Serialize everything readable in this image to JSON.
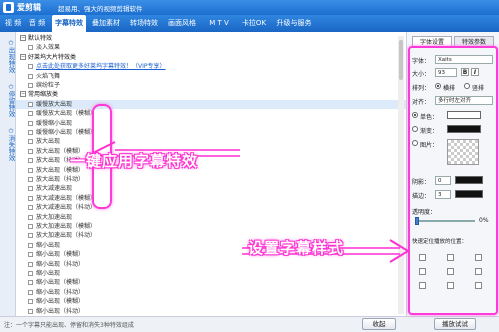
{
  "app": {
    "name": "爱剪辑",
    "slogan": "超易用、强大的视频剪辑软件"
  },
  "menu": [
    {
      "label": "视 频",
      "active": false
    },
    {
      "label": "音 频",
      "active": false
    },
    {
      "label": "字幕特效",
      "active": true
    },
    {
      "label": "叠加素材",
      "active": false
    },
    {
      "label": "转场特效",
      "active": false
    },
    {
      "label": "画面风格",
      "active": false
    },
    {
      "label": "M T V",
      "active": false
    },
    {
      "label": "卡拉OK",
      "active": false
    },
    {
      "label": "升级与服务",
      "active": false
    }
  ],
  "left_tabs": [
    "出现特效",
    "停留特效",
    "消失特效"
  ],
  "effects_list": [
    {
      "type": "group",
      "label": "默认特效"
    },
    {
      "type": "item",
      "label": "淡入效果"
    },
    {
      "type": "group",
      "label": "好莱坞大片特效类"
    },
    {
      "type": "link",
      "label": "点击此处获取更多好莱坞字幕特效！（VIP专享）"
    },
    {
      "type": "item",
      "label": "火焰飞舞"
    },
    {
      "type": "item",
      "label": "缤纷粒子"
    },
    {
      "type": "group",
      "label": "常用缩放类"
    },
    {
      "type": "item",
      "label": "缓慢放大出现",
      "selected": true
    },
    {
      "type": "item",
      "label": "缓慢放大出现（模糊）"
    },
    {
      "type": "item",
      "label": "缓慢缩小出现"
    },
    {
      "type": "item",
      "label": "缓慢缩小出现（模糊）"
    },
    {
      "type": "item",
      "label": "放大出现"
    },
    {
      "type": "item",
      "label": "放大出现（模糊）"
    },
    {
      "type": "item",
      "label": "放大出现（抖动）"
    },
    {
      "type": "item",
      "label": "放大出现（模糊）"
    },
    {
      "type": "item",
      "label": "放大出现（抖动）"
    },
    {
      "type": "item",
      "label": "放大减速出现"
    },
    {
      "type": "item",
      "label": "放大减速出现（模糊）"
    },
    {
      "type": "item",
      "label": "放大减速出现（抖动）"
    },
    {
      "type": "item",
      "label": "放大加速出现"
    },
    {
      "type": "item",
      "label": "放大加速出现（模糊）"
    },
    {
      "type": "item",
      "label": "放大加速出现（抖动）"
    },
    {
      "type": "item",
      "label": "缩小出现"
    },
    {
      "type": "item",
      "label": "缩小出现（模糊）"
    },
    {
      "type": "item",
      "label": "缩小出现（抖动）"
    },
    {
      "type": "item",
      "label": "缩小出现"
    },
    {
      "type": "item",
      "label": "缩小出现（模糊）"
    },
    {
      "type": "item",
      "label": "缩小出现（抖动）"
    },
    {
      "type": "item",
      "label": "缩小出现（模糊）"
    },
    {
      "type": "item",
      "label": "缩小出现（抖动）"
    }
  ],
  "bottom": {
    "hint": "注：一个字幕只能出现、停留和消失3种特效组成",
    "collect_label": "收起",
    "preview_label": "播放试试"
  },
  "right_panel": {
    "tabs": [
      "字体设置",
      "特效参数"
    ],
    "font_label": "字体：",
    "font_value": "Xaits",
    "size_label": "大小：",
    "size_value": "93",
    "bold_label": "B",
    "italic_label": "I",
    "align_label": "排列：",
    "align_horizontal": "横排",
    "align_vertical": "竖排",
    "layout_label": "对齐：",
    "layout_value": "多行时左对齐",
    "single_label": "单色：",
    "gradient_label": "渐变：",
    "image_label": "图片：",
    "shadow_label": "阴影：",
    "border_label": "描边：",
    "shadow_value": "0",
    "border_value": "3",
    "opacity_label": "透明度：",
    "opacity_value": "0%",
    "position_label": "快速定位播放的位置："
  },
  "callouts": {
    "one_click": "一键应用字幕特效",
    "set_style": "设置字幕样式"
  },
  "colors": {
    "accent": "#1a66c4",
    "callout": "#ff2fd0"
  }
}
